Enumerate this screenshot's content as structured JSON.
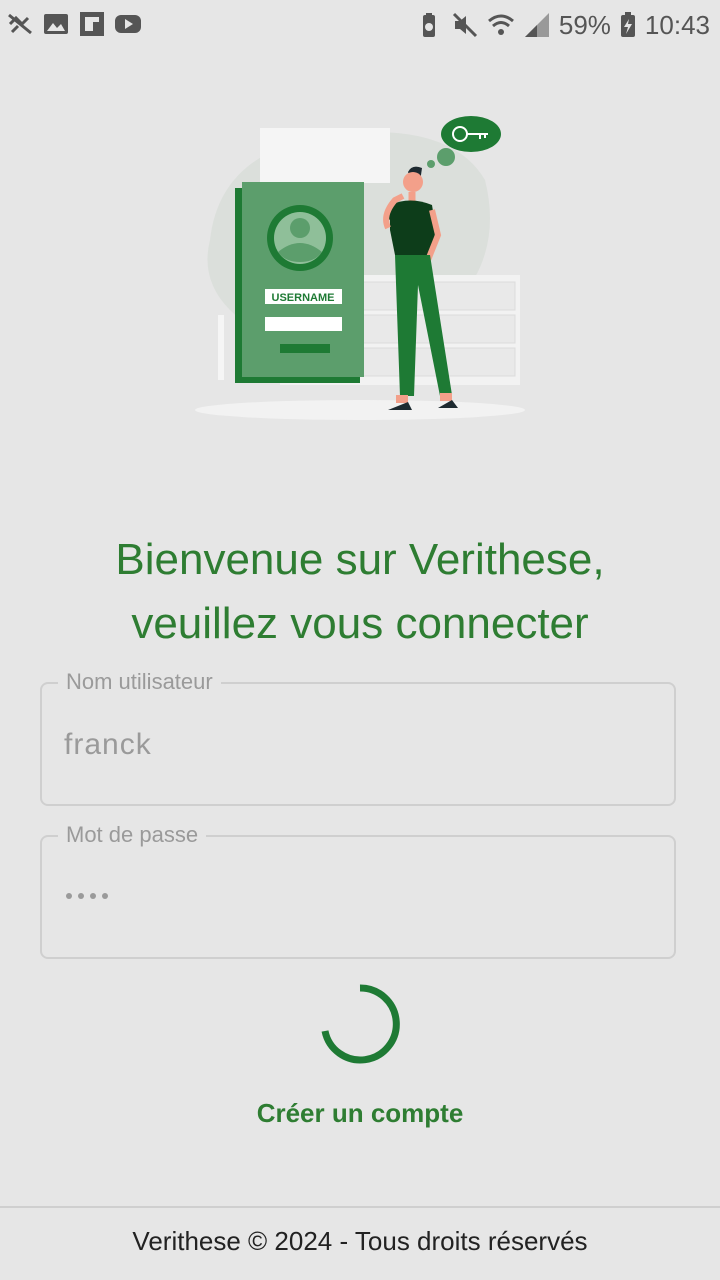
{
  "status_bar": {
    "battery_percent": "59%",
    "time": "10:43",
    "left_icons": [
      "no-signal-icon",
      "image-icon",
      "flipboard-icon",
      "youtube-icon"
    ],
    "right_icons": [
      "battery-saver-icon",
      "mute-icon",
      "wifi-icon",
      "cell-signal-icon",
      "battery-charging-icon"
    ]
  },
  "illustration": {
    "card_label": "USERNAME"
  },
  "header": {
    "line1": "Bienvenue sur Verithese,",
    "line2": "veuillez vous connecter"
  },
  "form": {
    "username_label": "Nom utilisateur",
    "username_value": "franck",
    "password_label": "Mot de passe",
    "password_length": 4
  },
  "actions": {
    "create_account": "Créer un compte"
  },
  "footer": {
    "text": "Verithese © 2024 - Tous droits réservés"
  },
  "colors": {
    "brand": "#2e7d32",
    "background": "#e6e6e6"
  }
}
